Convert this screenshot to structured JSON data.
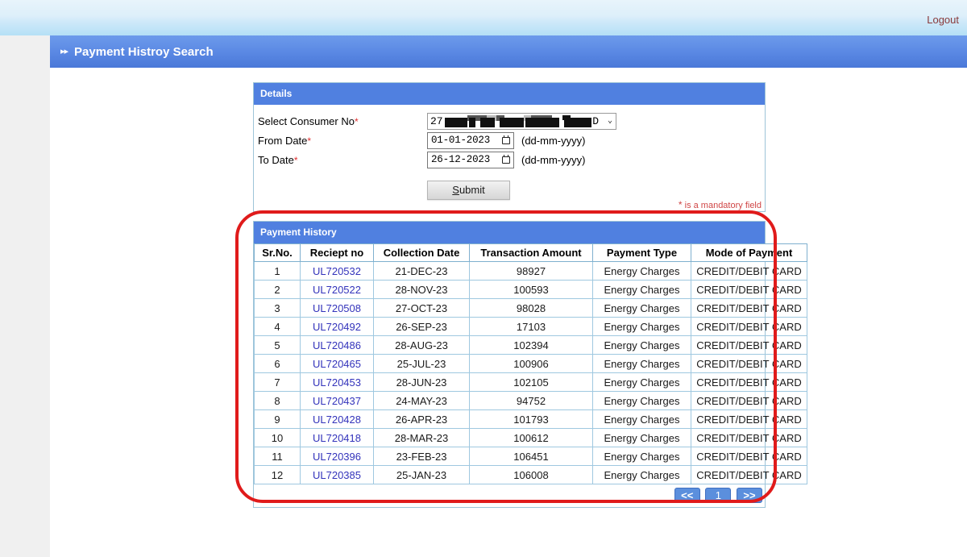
{
  "banner": {
    "logout_label": "Logout"
  },
  "page": {
    "title": "Payment Histroy Search",
    "bullet": "▸▸"
  },
  "details": {
    "panel_title": "Details",
    "consumer_label": "Select Consumer No",
    "consumer_value_prefix": "27",
    "consumer_value_suffix": "D",
    "consumer_caret": "⌄",
    "from_label": "From Date",
    "from_value": "01-01-2023",
    "to_label": "To Date",
    "to_value": "26-12-2023",
    "date_format_hint": "(dd-mm-yyyy)",
    "required_marker": "*",
    "submit_label_first": "S",
    "submit_label_rest": "ubmit",
    "mandatory_note_star": "*",
    "mandatory_note_text": " is a mandatory field"
  },
  "history": {
    "panel_title": "Payment History",
    "columns": [
      "Sr.No.",
      "Reciept no",
      "Collection Date",
      "Transaction Amount",
      "Payment Type",
      "Mode of Payment"
    ],
    "rows": [
      {
        "sr": "1",
        "receipt": "UL720532",
        "date": "21-DEC-23",
        "amount": "98927",
        "type": "Energy Charges",
        "mode": "CREDIT/DEBIT CARD"
      },
      {
        "sr": "2",
        "receipt": "UL720522",
        "date": "28-NOV-23",
        "amount": "100593",
        "type": "Energy Charges",
        "mode": "CREDIT/DEBIT CARD"
      },
      {
        "sr": "3",
        "receipt": "UL720508",
        "date": "27-OCT-23",
        "amount": "98028",
        "type": "Energy Charges",
        "mode": "CREDIT/DEBIT CARD"
      },
      {
        "sr": "4",
        "receipt": "UL720492",
        "date": "26-SEP-23",
        "amount": "17103",
        "type": "Energy Charges",
        "mode": "CREDIT/DEBIT CARD"
      },
      {
        "sr": "5",
        "receipt": "UL720486",
        "date": "28-AUG-23",
        "amount": "102394",
        "type": "Energy Charges",
        "mode": "CREDIT/DEBIT CARD"
      },
      {
        "sr": "6",
        "receipt": "UL720465",
        "date": "25-JUL-23",
        "amount": "100906",
        "type": "Energy Charges",
        "mode": "CREDIT/DEBIT CARD"
      },
      {
        "sr": "7",
        "receipt": "UL720453",
        "date": "28-JUN-23",
        "amount": "102105",
        "type": "Energy Charges",
        "mode": "CREDIT/DEBIT CARD"
      },
      {
        "sr": "8",
        "receipt": "UL720437",
        "date": "24-MAY-23",
        "amount": "94752",
        "type": "Energy Charges",
        "mode": "CREDIT/DEBIT CARD"
      },
      {
        "sr": "9",
        "receipt": "UL720428",
        "date": "26-APR-23",
        "amount": "101793",
        "type": "Energy Charges",
        "mode": "CREDIT/DEBIT CARD"
      },
      {
        "sr": "10",
        "receipt": "UL720418",
        "date": "28-MAR-23",
        "amount": "100612",
        "type": "Energy Charges",
        "mode": "CREDIT/DEBIT CARD"
      },
      {
        "sr": "11",
        "receipt": "UL720396",
        "date": "23-FEB-23",
        "amount": "106451",
        "type": "Energy Charges",
        "mode": "CREDIT/DEBIT CARD"
      },
      {
        "sr": "12",
        "receipt": "UL720385",
        "date": "25-JAN-23",
        "amount": "106008",
        "type": "Energy Charges",
        "mode": "CREDIT/DEBIT CARD"
      }
    ],
    "pager": {
      "prev_label": "<<",
      "current_page": "1",
      "next_label": ">>"
    }
  },
  "annotation": {
    "highlight_color": "#e01b1b"
  },
  "colors": {
    "panel_header_blue": "#5080e0",
    "title_bar_blue": "#5b89e4",
    "link_blue": "#3333bb",
    "required_red": "#e03030",
    "logout_maroon": "#8a3a3a"
  }
}
